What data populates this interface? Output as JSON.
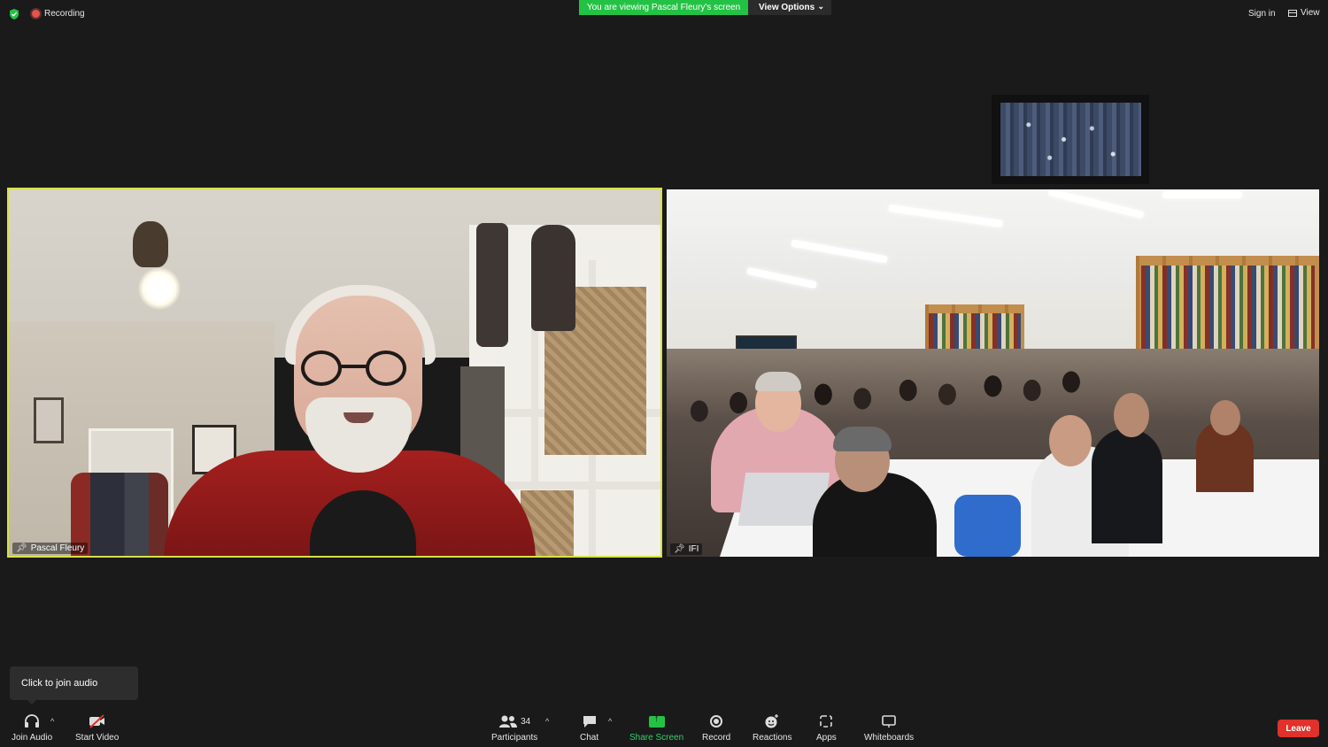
{
  "top_bar": {
    "recording_label": "Recording",
    "viewing_banner": "You are viewing Pascal Fleury's screen",
    "view_options_label": "View Options",
    "sign_in_label": "Sign in",
    "view_label": "View"
  },
  "tiles": [
    {
      "name": "Pascal Fleury",
      "active_speaker": true
    },
    {
      "name": "IFI",
      "active_speaker": false
    }
  ],
  "tooltip": {
    "text": "Click to join audio"
  },
  "toolbar": {
    "join_audio": "Join Audio",
    "start_video": "Start Video",
    "participants": "Participants",
    "participants_count": "34",
    "chat": "Chat",
    "share_screen": "Share Screen",
    "record": "Record",
    "reactions": "Reactions",
    "apps": "Apps",
    "whiteboards": "Whiteboards",
    "leave": "Leave"
  },
  "colors": {
    "background": "#1a1a1a",
    "banner_green": "#23c244",
    "speaker_border": "#d8e043",
    "leave_red": "#e0312b"
  }
}
